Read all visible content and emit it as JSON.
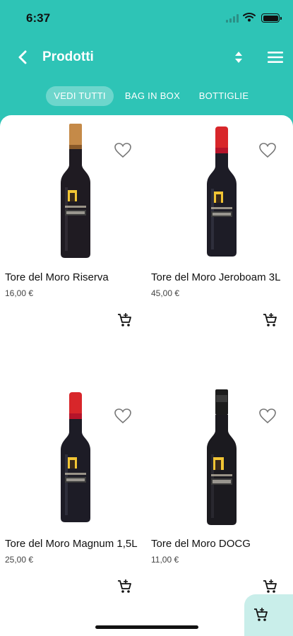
{
  "status_bar": {
    "time": "6:37"
  },
  "header": {
    "title": "Prodotti"
  },
  "tabs": [
    {
      "label": "VEDI TUTTI",
      "active": true
    },
    {
      "label": "BAG IN BOX",
      "active": false
    },
    {
      "label": "BOTTIGLIE",
      "active": false
    }
  ],
  "products": [
    {
      "name": "Tore del Moro Riserva",
      "price": "16,00 €",
      "cap_color": "#c58a48"
    },
    {
      "name": "Tore del Moro Jeroboam 3L",
      "price": "45,00 €",
      "cap_color": "#d8262a"
    },
    {
      "name": "Tore del Moro Magnum 1,5L",
      "price": "25,00 €",
      "cap_color": "#d8262a"
    },
    {
      "name": "Tore del Moro DOCG",
      "price": "11,00 €",
      "cap_color": "#1c1c1c"
    }
  ],
  "colors": {
    "accent": "#2ec4b6",
    "fab_bg": "#c9eeea"
  },
  "icons": [
    "back-arrow-icon",
    "sort-icon",
    "menu-icon",
    "heart-icon",
    "add-cart-icon"
  ]
}
